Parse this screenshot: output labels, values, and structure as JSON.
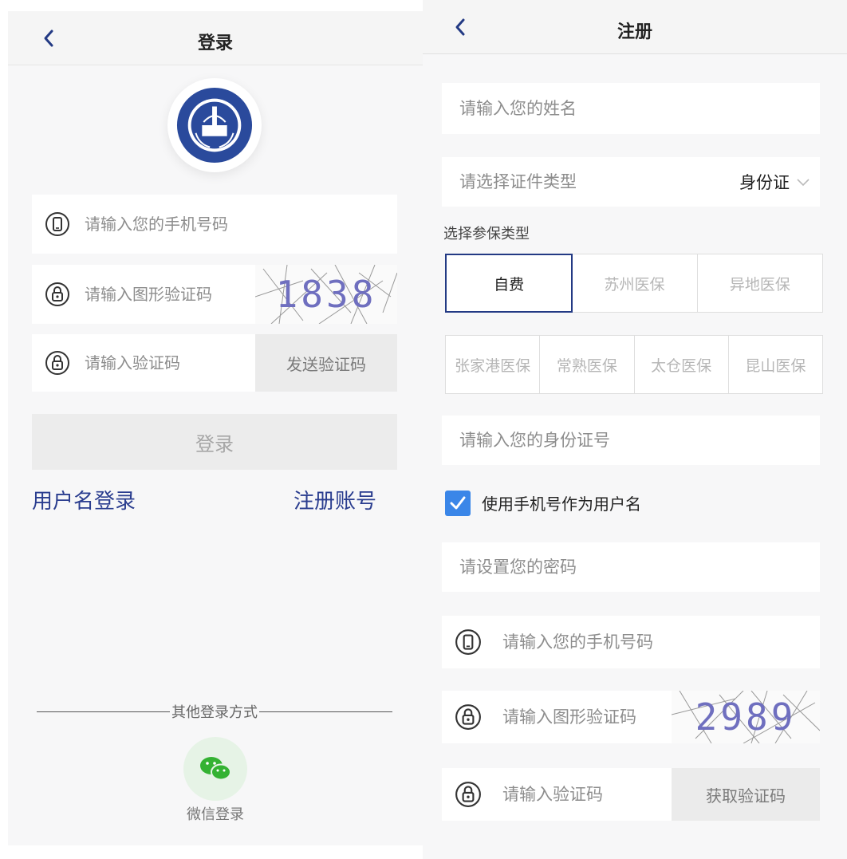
{
  "login": {
    "title": "登录",
    "phone_placeholder": "请输入您的手机号码",
    "captcha_placeholder": "请输入图形验证码",
    "captcha_text": "1838",
    "code_placeholder": "请输入验证码",
    "send_code_label": "发送验证码",
    "login_button": "登录",
    "username_login_link": "用户名登录",
    "register_link": "注册账号",
    "other_methods": "其他登录方式",
    "wechat_label": "微信登录"
  },
  "register": {
    "title": "注册",
    "name_placeholder": "请输入您的姓名",
    "id_type_label": "请选择证件类型",
    "id_type_value": "身份证",
    "insurance_section_label": "选择参保类型",
    "insurance_options_row1": [
      "自费",
      "苏州医保",
      "异地医保"
    ],
    "insurance_options_row2": [
      "张家港医保",
      "常熟医保",
      "太仓医保",
      "昆山医保"
    ],
    "selected_insurance": "自费",
    "id_number_placeholder": "请输入您的身份证号",
    "use_phone_checkbox_label": "使用手机号作为用户名",
    "use_phone_checked": true,
    "password_placeholder": "请设置您的密码",
    "phone_placeholder": "请输入您的手机号码",
    "captcha_placeholder": "请输入图形验证码",
    "captcha_text": "2989",
    "code_placeholder": "请输入验证码",
    "get_code_label": "获取验证码"
  },
  "colors": {
    "accent_navy": "#233a84",
    "link_blue": "#2a3d8f",
    "checkbox_blue": "#3a86e8",
    "wechat_green": "#34b233"
  }
}
